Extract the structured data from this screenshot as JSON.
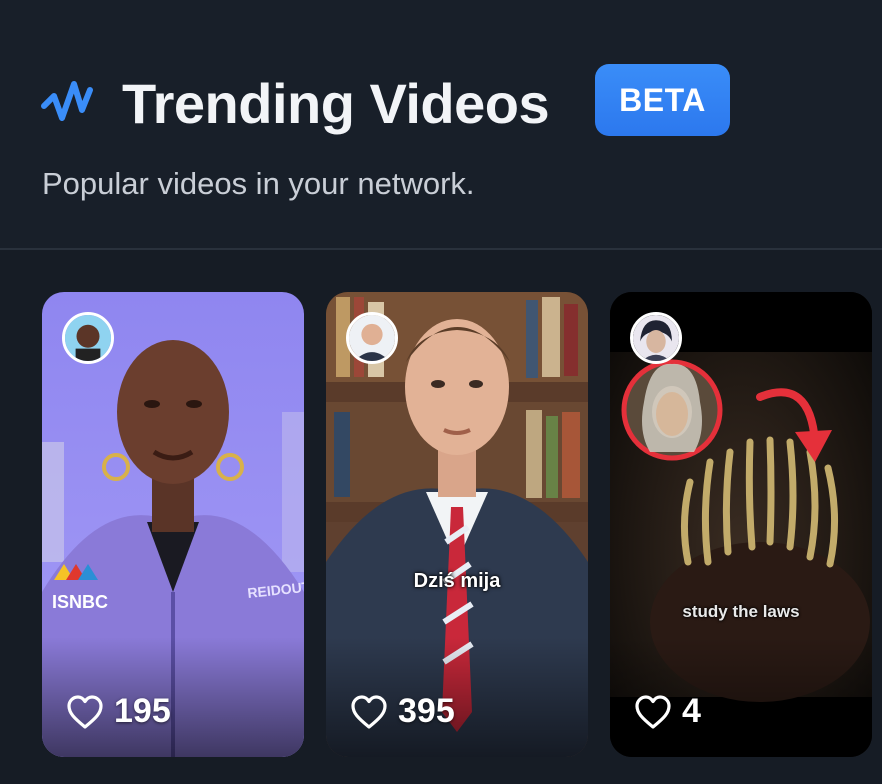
{
  "header": {
    "icon": "pulse-icon",
    "title": "Trending Videos",
    "badge": "BETA",
    "subtitle": "Popular videos in your network.",
    "accent_color": "#3a8df8"
  },
  "videos": [
    {
      "avatar_icon": "avatar-icon",
      "likes": "195",
      "overlay_texts": [
        "ISNBC",
        "REIDOUT"
      ],
      "caption": ""
    },
    {
      "avatar_icon": "avatar-icon",
      "likes": "395",
      "overlay_texts": [],
      "caption": "Dziś mija"
    },
    {
      "avatar_icon": "avatar-icon",
      "likes": "4",
      "overlay_texts": [],
      "caption": "study the laws"
    }
  ]
}
